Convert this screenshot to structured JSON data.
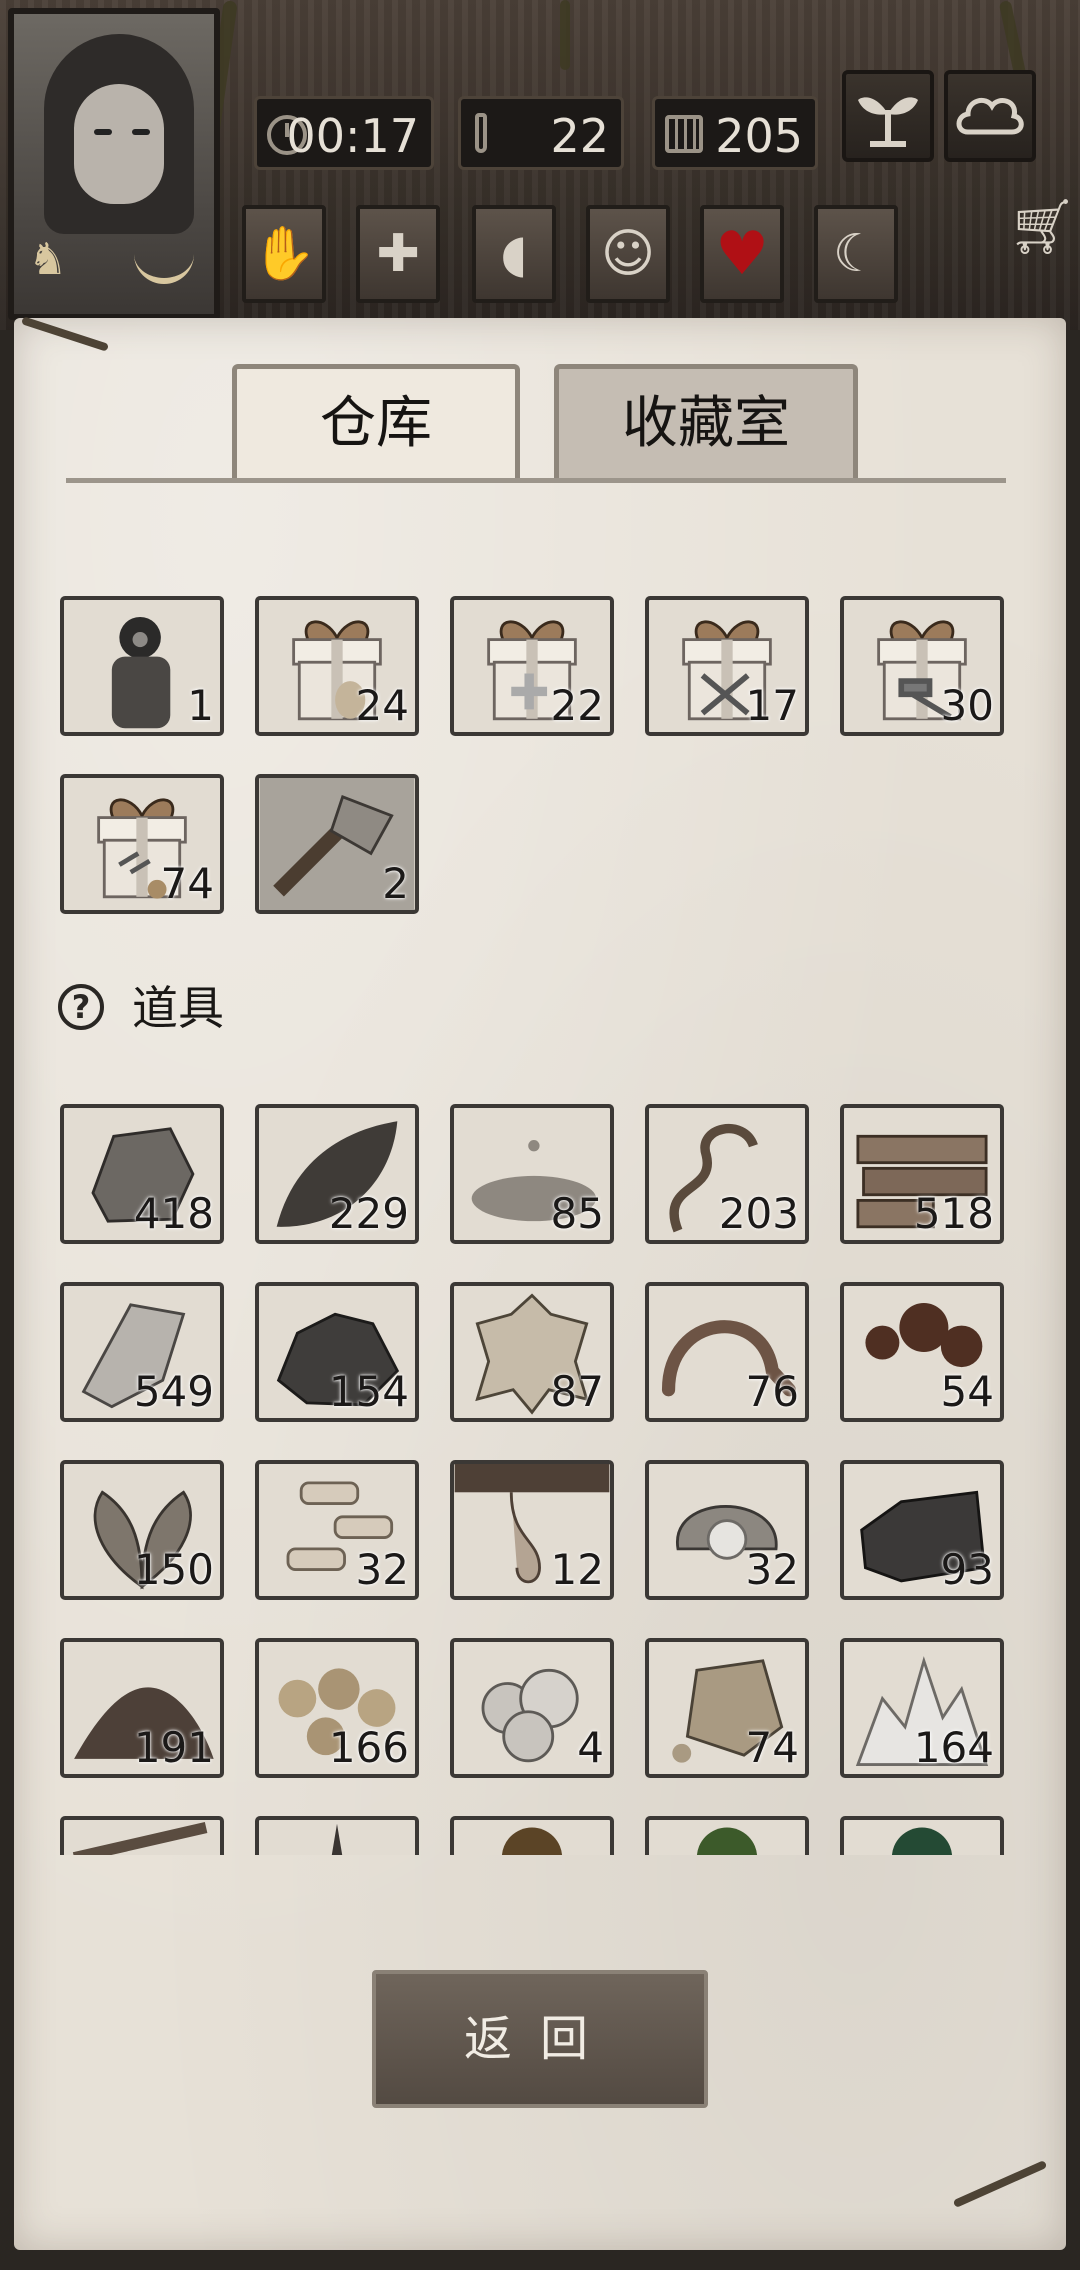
{
  "hud": {
    "time": "00:17",
    "temperature": "22",
    "day": "205",
    "icons": [
      "sprout-icon",
      "cloud-icon"
    ],
    "status_icons": [
      "hand-icon",
      "plus-icon",
      "stomach-icon",
      "head-icon",
      "heart-icon",
      "moon-icon"
    ],
    "cart_icon": "cart-icon"
  },
  "tabs": [
    {
      "label": "仓库",
      "active": true
    },
    {
      "label": "收藏室",
      "active": false
    }
  ],
  "top_items": [
    {
      "name": "hazmat-suit",
      "count": "1"
    },
    {
      "name": "gift-box-furniture",
      "count": "24"
    },
    {
      "name": "gift-box-medical",
      "count": "22"
    },
    {
      "name": "gift-box-tools",
      "count": "17"
    },
    {
      "name": "gift-box-weapons",
      "count": "30"
    },
    {
      "name": "gift-box-misc",
      "count": "74"
    },
    {
      "name": "stone-axe",
      "count": "2"
    }
  ],
  "section": {
    "label": "道具"
  },
  "items": [
    {
      "name": "stone",
      "count": "418"
    },
    {
      "name": "leaf",
      "count": "229"
    },
    {
      "name": "water-puddle",
      "count": "85"
    },
    {
      "name": "vine",
      "count": "203"
    },
    {
      "name": "wood-planks",
      "count": "518"
    },
    {
      "name": "flint",
      "count": "549"
    },
    {
      "name": "ore",
      "count": "154"
    },
    {
      "name": "animal-hide",
      "count": "87"
    },
    {
      "name": "worm",
      "count": "76"
    },
    {
      "name": "oil-stain",
      "count": "54"
    },
    {
      "name": "herb",
      "count": "150"
    },
    {
      "name": "bone-pieces",
      "count": "32"
    },
    {
      "name": "resin",
      "count": "12"
    },
    {
      "name": "pearl-shell",
      "count": "32"
    },
    {
      "name": "coal",
      "count": "93"
    },
    {
      "name": "soil",
      "count": "191"
    },
    {
      "name": "gold-nuggets",
      "count": "166"
    },
    {
      "name": "cotton",
      "count": "4"
    },
    {
      "name": "clay-lump",
      "count": "74"
    },
    {
      "name": "salt-crystals",
      "count": "164"
    },
    {
      "name": "sticks",
      "count": ""
    },
    {
      "name": "spike",
      "count": ""
    },
    {
      "name": "brown-orb",
      "count": ""
    },
    {
      "name": "green-orb",
      "count": ""
    },
    {
      "name": "dark-green-orb",
      "count": ""
    }
  ],
  "back_button": "返回"
}
